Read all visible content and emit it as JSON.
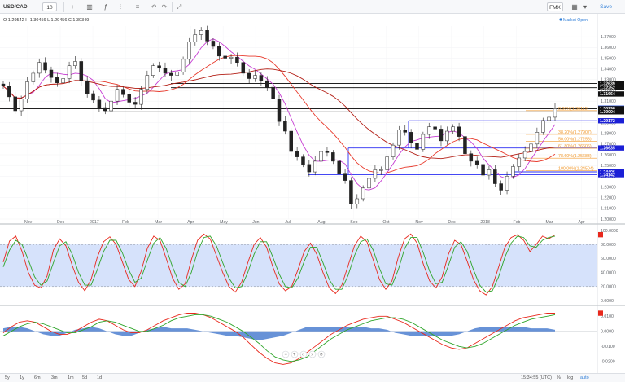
{
  "toolbar": {
    "symbol": "USD/CAD",
    "interval": "10",
    "right_interval": "FMX",
    "save_label": "Save",
    "icons": [
      "plus-icon",
      "candles-icon",
      "indicators-icon",
      "compare-icon",
      "undo-icon",
      "redo-icon",
      "fullscreen-icon",
      "layout-icon",
      "settings-icon"
    ]
  },
  "legend": {
    "ohlc": "O 1.29542 H 1.30456 L 1.29456 C 1.30349",
    "market_status": "Market Open"
  },
  "bottom_bar": {
    "ranges": [
      "5y",
      "1y",
      "6m",
      "3m",
      "1m",
      "5d",
      "1d"
    ],
    "time": "15:34:55 (UTC)",
    "percent": "%",
    "log": "log",
    "auto": "auto"
  },
  "colors": {
    "up_candle": "#ffffff",
    "down_candle": "#222222",
    "price_line_black": "#000000",
    "ma_fast": "#c63cd2",
    "ma_slow": "#e83a2c",
    "ma_long": "#b31f16",
    "level_blue": "#2a2df2",
    "fib_orange": "#f29a2e",
    "tag_black": "#111111",
    "tag_blue": "#1b1fd6",
    "stoch_band": "#d6e2fb",
    "stoch_k": "#e8281c",
    "stoch_d": "#2fa52a",
    "hist_fill": "#4c7fd0",
    "macd_line": "#e8281c",
    "signal_line": "#2fa52a",
    "current_price_tag": "#2a4fd6"
  },
  "chart_data": [
    {
      "type": "candlestick",
      "title": "",
      "x": [
        "Nov",
        "Dec",
        "2017",
        "Feb",
        "Mar",
        "Apr",
        "May",
        "Jun",
        "Jul",
        "Aug",
        "Sep",
        "Oct",
        "Nov",
        "Dec",
        "2018",
        "Feb",
        "Mar",
        "Apr"
      ],
      "ylim": [
        1.2,
        1.38
      ],
      "y_ticks": [
        "1.37000",
        "1.36000",
        "1.35000",
        "1.34000",
        "1.33000",
        "1.32000",
        "1.31000",
        "1.30000",
        "1.29000",
        "1.28000",
        "1.27000",
        "1.26000",
        "1.25000",
        "1.24000",
        "1.23000",
        "1.22000",
        "1.21000",
        "1.20000"
      ],
      "close_series": [
        1.324,
        1.314,
        1.301,
        1.312,
        1.328,
        1.336,
        1.346,
        1.339,
        1.332,
        1.327,
        1.331,
        1.343,
        1.347,
        1.329,
        1.317,
        1.311,
        1.304,
        1.301,
        1.31,
        1.321,
        1.316,
        1.309,
        1.307,
        1.321,
        1.334,
        1.343,
        1.341,
        1.336,
        1.334,
        1.337,
        1.349,
        1.365,
        1.372,
        1.376,
        1.366,
        1.361,
        1.352,
        1.35,
        1.351,
        1.346,
        1.336,
        1.331,
        1.334,
        1.329,
        1.323,
        1.312,
        1.291,
        1.282,
        1.263,
        1.258,
        1.251,
        1.244,
        1.254,
        1.263,
        1.262,
        1.254,
        1.242,
        1.236,
        1.214,
        1.219,
        1.229,
        1.238,
        1.246,
        1.246,
        1.258,
        1.269,
        1.283,
        1.281,
        1.271,
        1.265,
        1.279,
        1.286,
        1.284,
        1.273,
        1.282,
        1.286,
        1.277,
        1.261,
        1.254,
        1.251,
        1.241,
        1.246,
        1.233,
        1.227,
        1.24,
        1.249,
        1.257,
        1.263,
        1.27,
        1.281,
        1.292,
        1.295,
        1.303
      ],
      "levels": [
        {
          "price": 1.32639,
          "label": "1.32639",
          "color": "#111111"
        },
        {
          "price": 1.32252,
          "label": "1.32252",
          "color": "#111111"
        },
        {
          "price": 1.31664,
          "label": "1.31664",
          "color": "#111111"
        },
        {
          "price": 1.30349,
          "label": "1.30349",
          "color": "#2a4fd6"
        },
        {
          "price": 1.30298,
          "label": "1.30298",
          "color": "#111111"
        },
        {
          "price": 1.30004,
          "label": "1.30004",
          "color": "#111111"
        },
        {
          "price": 1.29172,
          "label": "1.29172",
          "color": "#1b1fd6"
        },
        {
          "price": 1.26635,
          "label": "1.26635",
          "color": "#1b1fd6"
        },
        {
          "price": 1.24406,
          "label": "1.24406",
          "color": "#1b1fd6"
        },
        {
          "price": 1.24142,
          "label": "1.24142",
          "color": "#1b1fd6"
        }
      ],
      "fibonacci": [
        {
          "label": "0.00%(1.30115)",
          "price": 1.30115
        },
        {
          "label": "38.20%(1.27907)",
          "price": 1.27907
        },
        {
          "label": "50.00%(1.27258)",
          "price": 1.27258
        },
        {
          "label": "61.80%(1.26606)",
          "price": 1.26606
        },
        {
          "label": "78.60%(1.25683)",
          "price": 1.25683
        },
        {
          "label": "100.00%(1.24504)",
          "price": 1.24504
        }
      ]
    },
    {
      "type": "line",
      "title": "",
      "ylim": [
        0,
        100
      ],
      "y_ticks": [
        "100.0000",
        "80.0000",
        "60.0000",
        "40.0000",
        "20.0000",
        "0.0000"
      ],
      "band": [
        20,
        80
      ],
      "series": [
        {
          "values": [
            55,
            85,
            92,
            70,
            40,
            22,
            18,
            35,
            72,
            88,
            78,
            50,
            26,
            14,
            30,
            62,
            84,
            91,
            80,
            55,
            30,
            20,
            42,
            75,
            92,
            86,
            60,
            32,
            16,
            24,
            58,
            86,
            95,
            88,
            64,
            40,
            20,
            12,
            26,
            54,
            80,
            90,
            76,
            48,
            24,
            14,
            20,
            44,
            70,
            82,
            66,
            40,
            18,
            10,
            22,
            50,
            78,
            92,
            84,
            58,
            30,
            16,
            28,
            62,
            88,
            95,
            82,
            52,
            28,
            18,
            34,
            66,
            86,
            80,
            56,
            30,
            14,
            8,
            20,
            48,
            76,
            90,
            94,
            86,
            70,
            80,
            92,
            88,
            94
          ]
        },
        {
          "values": [
            48,
            72,
            86,
            80,
            58,
            34,
            22,
            28,
            54,
            78,
            84,
            66,
            40,
            22,
            22,
            44,
            70,
            86,
            86,
            68,
            44,
            26,
            32,
            58,
            82,
            90,
            74,
            48,
            26,
            20,
            40,
            70,
            90,
            92,
            78,
            54,
            32,
            18,
            20,
            40,
            66,
            84,
            84,
            62,
            38,
            20,
            18,
            32,
            56,
            76,
            76,
            54,
            30,
            16,
            16,
            36,
            64,
            84,
            88,
            72,
            46,
            24,
            22,
            44,
            74,
            90,
            90,
            68,
            42,
            24,
            26,
            50,
            76,
            84,
            70,
            44,
            22,
            12,
            14,
            34,
            62,
            82,
            92,
            90,
            78,
            76,
            86,
            90,
            92
          ]
        }
      ]
    },
    {
      "type": "line",
      "title": "",
      "ylim": [
        -0.025,
        0.015
      ],
      "y_ticks": [
        "0.0100",
        "0.0000",
        "-0.0100",
        "-0.0200"
      ],
      "series": [
        {
          "values": [
            -0.001,
            0.003,
            0.006,
            0.007,
            0.006,
            0.003,
            0.0,
            -0.002,
            -0.002,
            0.0,
            0.003,
            0.006,
            0.008,
            0.007,
            0.004,
            0.001,
            -0.001,
            -0.001,
            0.001,
            0.004,
            0.007,
            0.009,
            0.011,
            0.012,
            0.012,
            0.011,
            0.009,
            0.006,
            0.003,
            0.0,
            -0.004,
            -0.009,
            -0.014,
            -0.018,
            -0.021,
            -0.022,
            -0.021,
            -0.018,
            -0.014,
            -0.01,
            -0.006,
            -0.002,
            0.001,
            0.004,
            0.006,
            0.008,
            0.009,
            0.01,
            0.01,
            0.008,
            0.006,
            0.003,
            0.0,
            -0.003,
            -0.006,
            -0.009,
            -0.011,
            -0.012,
            -0.011,
            -0.008,
            -0.005,
            -0.002,
            0.001,
            0.004,
            0.007,
            0.009,
            0.01,
            0.011,
            0.012,
            0.012
          ]
        },
        {
          "values": [
            -0.003,
            0.0,
            0.003,
            0.005,
            0.006,
            0.005,
            0.003,
            0.001,
            -0.001,
            -0.001,
            0.001,
            0.003,
            0.006,
            0.007,
            0.006,
            0.004,
            0.002,
            0.0,
            0.0,
            0.002,
            0.004,
            0.007,
            0.009,
            0.01,
            0.011,
            0.011,
            0.01,
            0.008,
            0.006,
            0.003,
            0.0,
            -0.004,
            -0.008,
            -0.013,
            -0.017,
            -0.019,
            -0.02,
            -0.019,
            -0.017,
            -0.013,
            -0.009,
            -0.005,
            -0.002,
            0.001,
            0.003,
            0.005,
            0.007,
            0.008,
            0.009,
            0.009,
            0.008,
            0.006,
            0.003,
            0.0,
            -0.003,
            -0.006,
            -0.008,
            -0.01,
            -0.011,
            -0.01,
            -0.008,
            -0.005,
            -0.002,
            0.001,
            0.004,
            0.006,
            0.008,
            0.009,
            0.01,
            0.011
          ]
        }
      ],
      "histogram": [
        0.002,
        0.003,
        0.003,
        0.002,
        0.0,
        -0.002,
        -0.003,
        -0.003,
        -0.001,
        0.001,
        0.002,
        0.003,
        0.002,
        0.0,
        -0.002,
        -0.003,
        -0.003,
        -0.001,
        0.001,
        0.002,
        0.003,
        0.002,
        0.002,
        0.002,
        0.001,
        0.0,
        -0.001,
        -0.002,
        -0.003,
        -0.003,
        -0.004,
        -0.005,
        -0.006,
        -0.005,
        -0.004,
        -0.003,
        -0.001,
        0.001,
        0.003,
        0.003,
        0.003,
        0.003,
        0.003,
        0.003,
        0.003,
        0.003,
        0.002,
        0.002,
        0.001,
        -0.001,
        -0.002,
        -0.003,
        -0.003,
        -0.003,
        -0.003,
        -0.003,
        -0.003,
        -0.002,
        0.0,
        0.002,
        0.003,
        0.003,
        0.003,
        0.003,
        0.003,
        0.003,
        0.002,
        0.002,
        0.002,
        0.001
      ]
    }
  ]
}
